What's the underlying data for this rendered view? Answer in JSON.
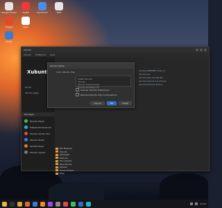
{
  "desktop": {
    "icons": [
      {
        "label": "Google Chrome",
        "color": "#e5e5e5"
      },
      {
        "label": "Vivaldi",
        "color": "#ef3939"
      },
      {
        "label": "Chromium",
        "color": "#4a8fe7"
      },
      {
        "label": "Files",
        "color": "#e6e6e6"
      },
      {
        "label": "Dragon",
        "color": "#e24a2a"
      },
      {
        "label": "Apps",
        "color": "#ffffff"
      },
      {
        "label": "Finder",
        "color": "#3a7bd5"
      }
    ]
  },
  "window": {
    "title": "Ubuntu",
    "tabs": [
      "Ubuntu",
      "Softwares",
      "Apps"
    ],
    "sidebar": {
      "logo": "Xubuntu",
      "rows": [
        "Home",
        "Ubuntu Apps"
      ],
      "list_header": "Packages",
      "apps": [
        {
          "label": "Ubuntu Player",
          "color": "#3fbf5a"
        },
        {
          "label": "PulseAudio Panel CLI",
          "color": "#2bb3c6"
        },
        {
          "label": "Ubuntu Screen Tool",
          "color": "#e24848"
        },
        {
          "label": "Ubuntu Picker",
          "color": "#3d7ee0"
        },
        {
          "label": "Spotify Player",
          "color": "#e07b2a"
        },
        {
          "label": "Ubuntu Layout",
          "color": "#7a7a7a"
        }
      ]
    }
  },
  "dialog": {
    "title": "Ubuntu Setup",
    "subtitle": "1.0.1 Ubuntu chip",
    "box_lines": [
      "Install Ubuntu",
      "Ubuntu",
      "Ubuntu Environment",
      "Ubuntu Package Info"
    ],
    "check1": "Include 'Ubuntu' Extensions",
    "check2": "Remove Ubuntu Tray Compositions",
    "buttons": {
      "cancel": "Cancel",
      "ok": "OK",
      "install": "Install"
    }
  },
  "right_panel": {
    "lines": [
      "ubuntu_ZPRIMET_FULL_K",
      "ubuntu.sys",
      "ubuntu.kern-2.6.28.dev",
      "ubuntu.mod.ko.4.2.drivers",
      "ubuntu.init.lock.14.0.0"
    ]
  },
  "folders": [
    "Bin Binaries",
    "Ubuntu",
    "Packages",
    "Pictures",
    "Documents",
    "Boot Drives",
    "Shared",
    "Home Folders",
    "Files"
  ],
  "taskbar": {
    "icons": [
      {
        "name": "chrome-icon",
        "color": "#e8b73a"
      },
      {
        "name": "terminal-icon",
        "color": "#333333"
      },
      {
        "name": "files-icon",
        "color": "#e0a23a"
      },
      {
        "name": "firefox-icon",
        "color": "#e06a2a"
      },
      {
        "name": "mail-icon",
        "color": "#3a7bd5"
      },
      {
        "name": "vlc-icon",
        "color": "#f08a24"
      },
      {
        "name": "music-icon",
        "color": "#9b4be0"
      },
      {
        "name": "settings-icon",
        "color": "#888888"
      },
      {
        "name": "store-icon",
        "color": "#e24848"
      },
      {
        "name": "photos-icon",
        "color": "#3fbf5a"
      },
      {
        "name": "code-icon",
        "color": "#2f6fbf"
      },
      {
        "name": "chat-icon",
        "color": "#2bb3c6"
      }
    ],
    "clock": "11:12"
  }
}
